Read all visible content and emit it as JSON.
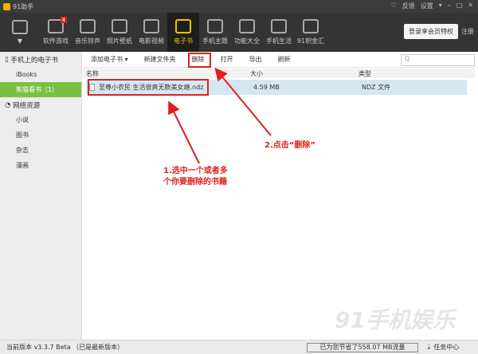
{
  "app": {
    "title": "91助手",
    "window_controls": [
      "♡",
      "反馈",
      "设置",
      "▾",
      "–",
      "□",
      "✕"
    ]
  },
  "toolbar": {
    "items": [
      {
        "label": "",
        "icon": "hi-icon"
      },
      {
        "label": "软件游戏",
        "icon": "apps-icon",
        "badge": "4"
      },
      {
        "label": "音乐铃声",
        "icon": "music-icon"
      },
      {
        "label": "照片壁纸",
        "icon": "photo-icon"
      },
      {
        "label": "电影视频",
        "icon": "video-icon"
      },
      {
        "label": "电子书",
        "icon": "ebook-icon",
        "selected": true
      },
      {
        "label": "手机主题",
        "icon": "theme-icon"
      },
      {
        "label": "功能大全",
        "icon": "tools-icon"
      },
      {
        "label": "手机生活",
        "icon": "life-icon"
      },
      {
        "label": "91积金汇",
        "icon": "points-icon"
      }
    ],
    "login": "登录享会员特权",
    "register": "注册"
  },
  "sidebar": {
    "phone_header": "手机上的电子书",
    "items": [
      "iBooks",
      "熊猫看书（1）"
    ],
    "net_header": "网络资源",
    "net_items": [
      "小说",
      "图书",
      "杂志",
      "漫画"
    ]
  },
  "actions": {
    "add": "添加电子书 ▾",
    "new_folder": "新建文件夹",
    "delete": "删除",
    "open": "打开",
    "export": "导出",
    "refresh": "刷新",
    "search_icon": "Q"
  },
  "table": {
    "headers": [
      "名称",
      "大小",
      "类型"
    ],
    "rows": [
      {
        "name": "至尊小农民 生活很爽无数美女缠.ndz",
        "size": "4.59 MB",
        "type": "NDZ 文件"
      }
    ]
  },
  "annotations": {
    "step1": [
      "1.选中一个或者多",
      "个你要删除的书籍"
    ],
    "step2": "2.点击“删除”"
  },
  "status": {
    "version": "当前版本 v3.3.7 Beta （已是最新版本）",
    "saved": "已为您节省了558.07 MB流量",
    "task": "任务中心"
  },
  "watermark": "91手机娱乐",
  "colors": {
    "accent": "#7ac143",
    "annotation": "#e02020",
    "selected_tab": "#f0c000"
  }
}
